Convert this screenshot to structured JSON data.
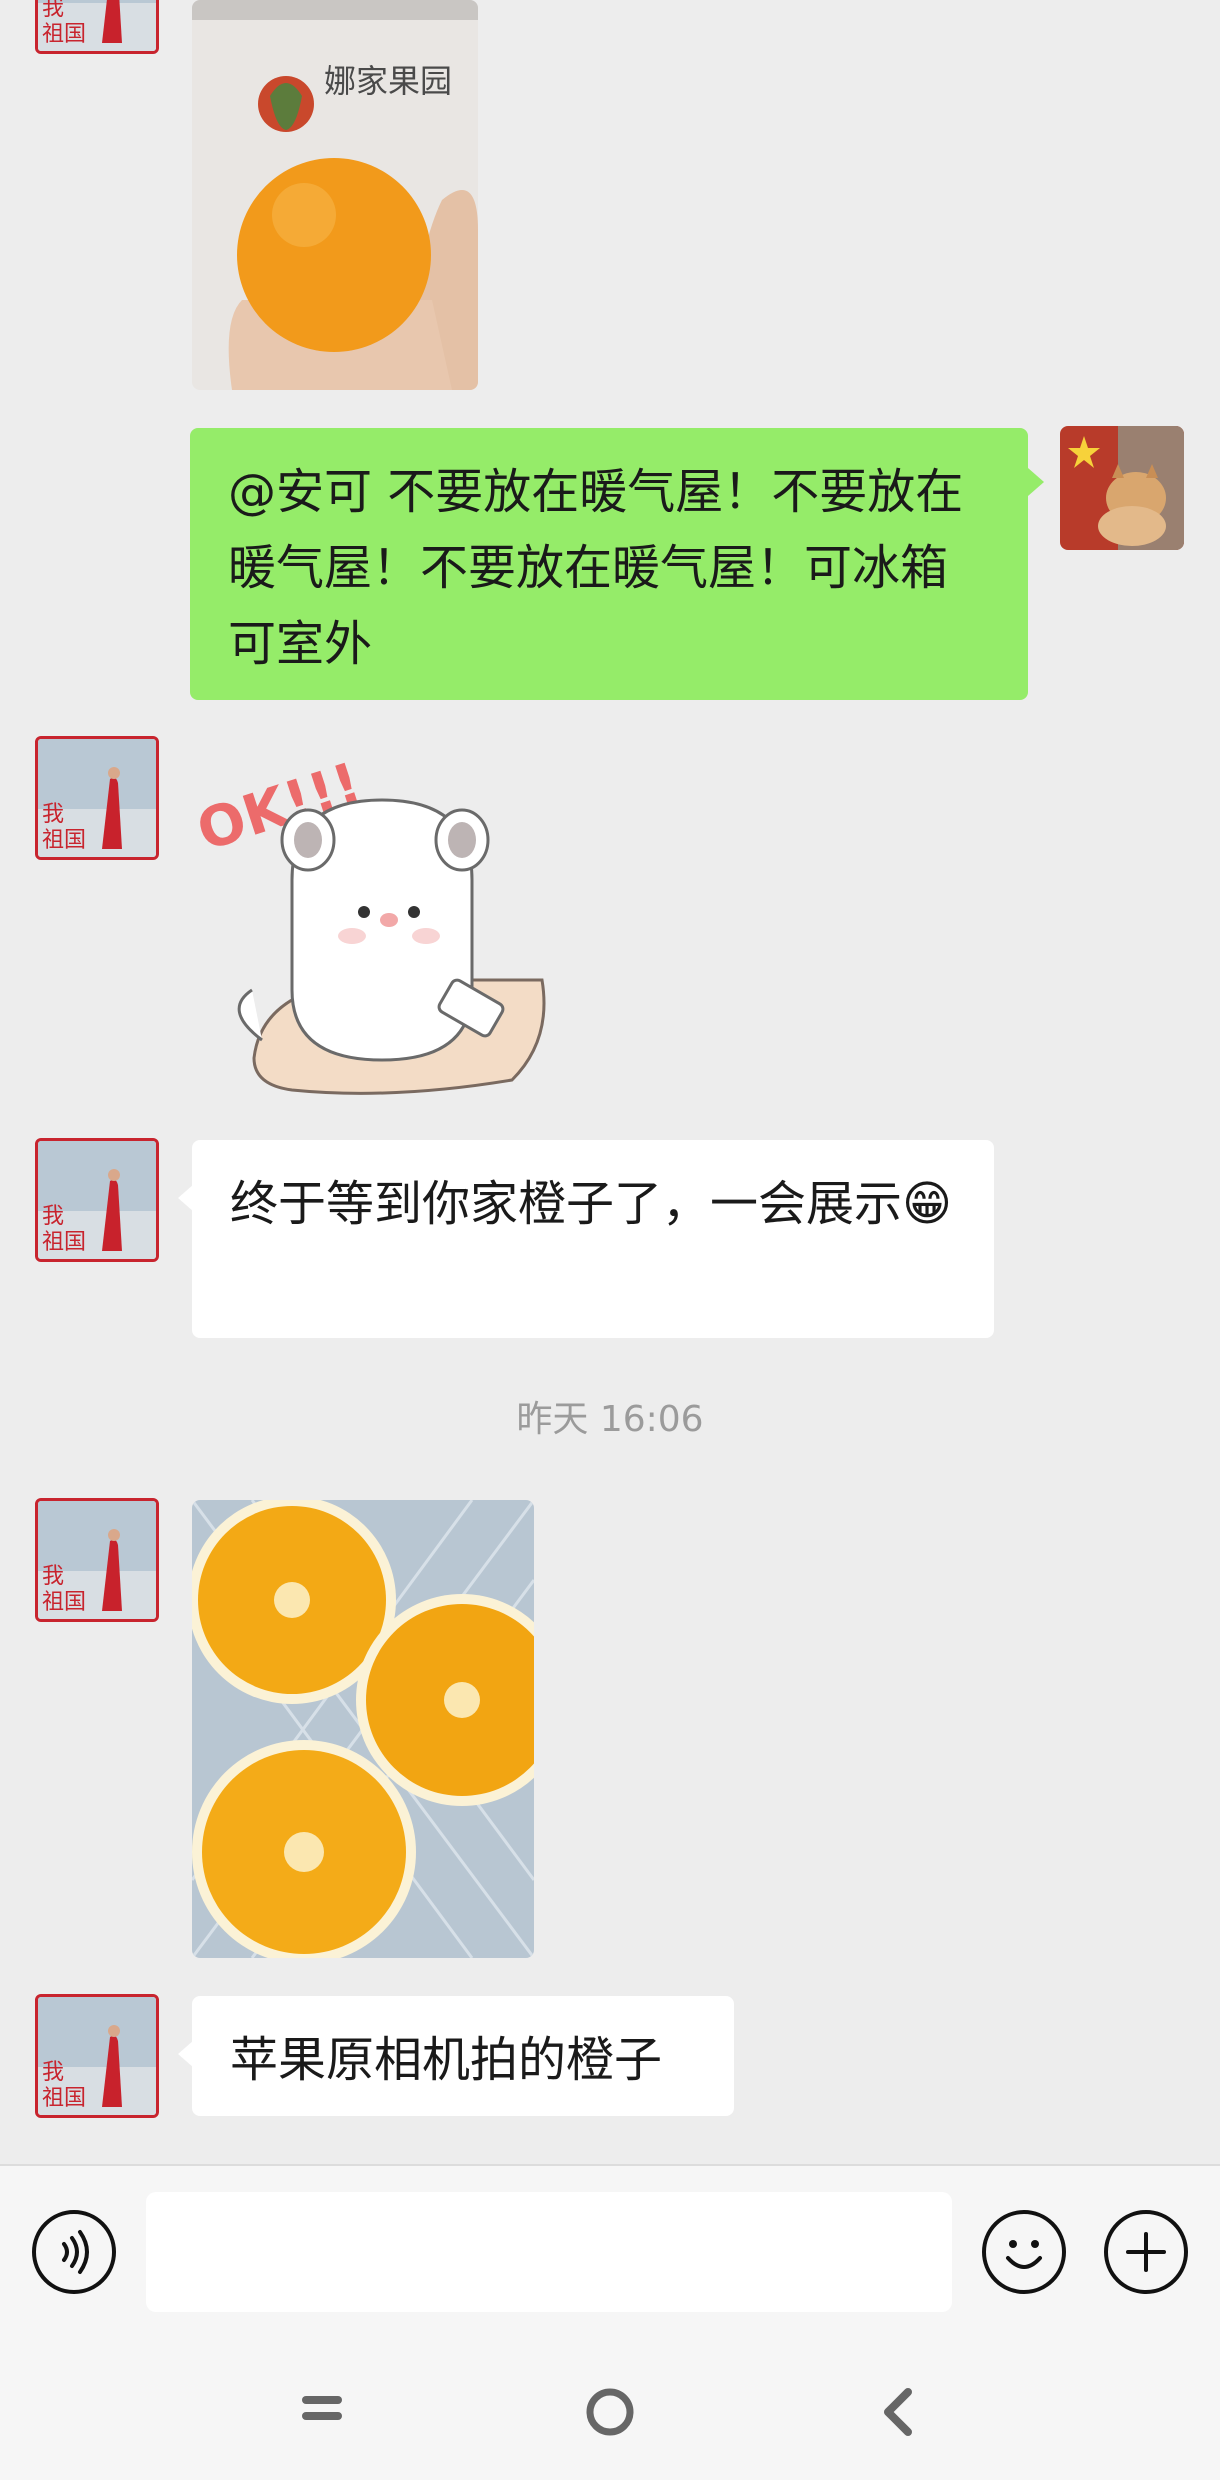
{
  "messages": {
    "m1_text": "@安可  不要放在暖气屋！不要放在暖气屋！不要放在暖气屋！可冰箱可室外",
    "m2_sticker_text": "OK!!!",
    "m3_text": "终于等到你家橙子了，一会展示😁",
    "timestamp": "昨天 16:06",
    "m5_text": "苹果原相机拍的橙子"
  },
  "photo1": {
    "brand": "娜家果园"
  },
  "avatars": {
    "other_caption_1": "我",
    "other_caption_2": "祖国"
  },
  "colors": {
    "background": "#ededed",
    "self_bubble": "#95ec69",
    "other_bubble": "#ffffff",
    "avatar_border": "#c8242e"
  },
  "input_bar": {
    "voice_icon": "voice-icon",
    "emoji_icon": "emoji-icon",
    "plus_icon": "plus-icon"
  },
  "nav_bar": {
    "menu_icon": "menu-icon",
    "home_icon": "home-icon",
    "back_icon": "back-icon"
  }
}
